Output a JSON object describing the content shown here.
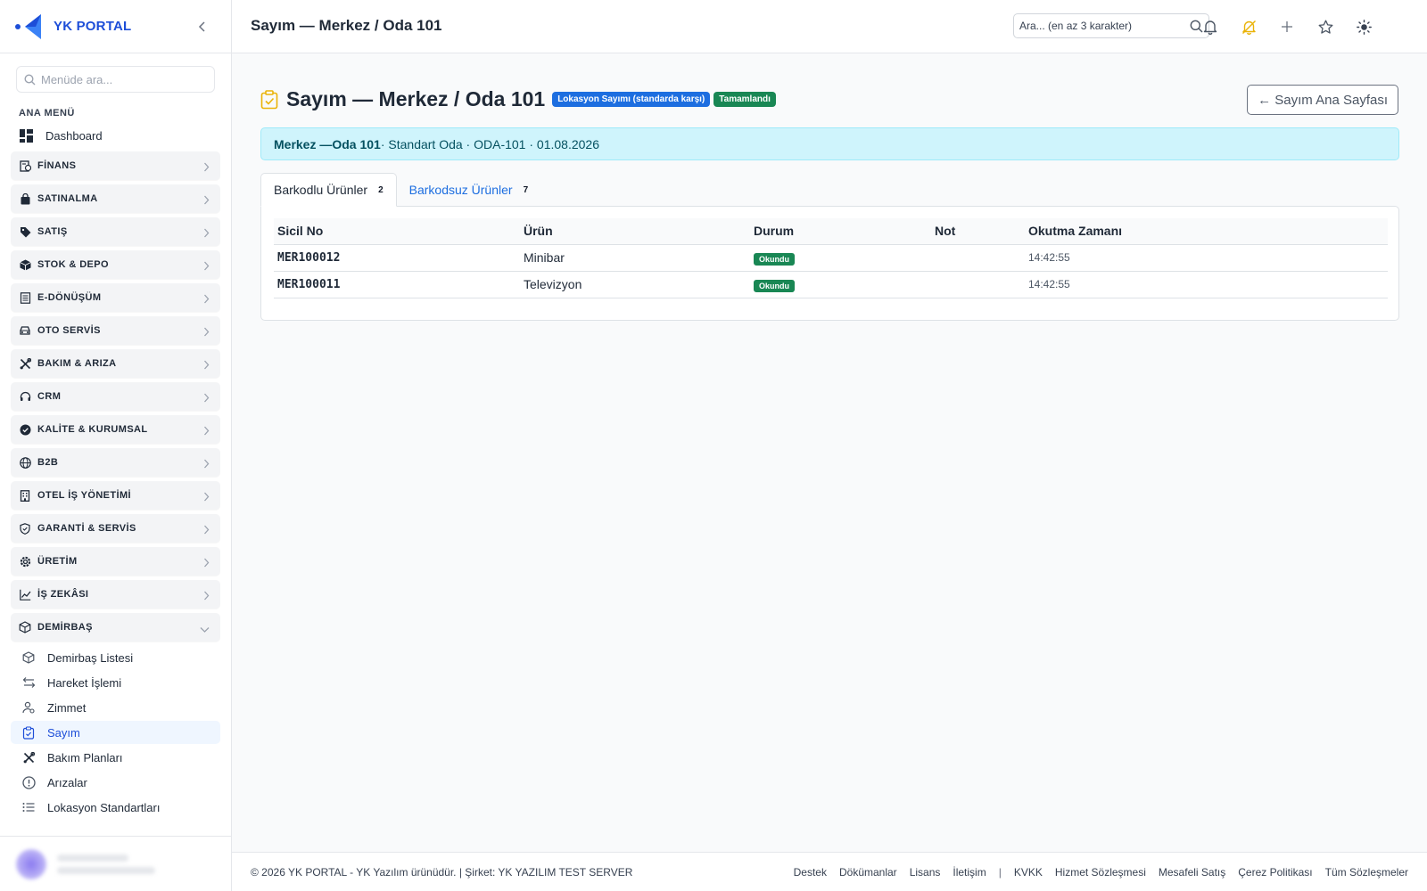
{
  "brand": {
    "name": "YK PORTAL"
  },
  "sidebar": {
    "search_placeholder": "Menüde ara...",
    "section_label": "ANA MENÜ",
    "dashboard": "Dashboard",
    "groups": [
      {
        "label": "FİNANS",
        "icon": "finance-icon"
      },
      {
        "label": "SATINALMA",
        "icon": "shopping-bag-icon"
      },
      {
        "label": "SATIŞ",
        "icon": "tag-icon"
      },
      {
        "label": "STOK & DEPO",
        "icon": "box-icon"
      },
      {
        "label": "E-DÖNÜŞÜM",
        "icon": "receipt-icon"
      },
      {
        "label": "OTO SERVİS",
        "icon": "car-icon"
      },
      {
        "label": "BAKIM & ARIZA",
        "icon": "tools-icon"
      },
      {
        "label": "CRM",
        "icon": "headset-icon"
      },
      {
        "label": "KALİTE & KURUMSAL",
        "icon": "award-icon"
      },
      {
        "label": "B2B",
        "icon": "globe-icon"
      },
      {
        "label": "OTEL İŞ YÖNETİMİ",
        "icon": "building-icon"
      },
      {
        "label": "GARANTİ & SERVİS",
        "icon": "shield-icon"
      },
      {
        "label": "ÜRETİM",
        "icon": "gear-icon"
      },
      {
        "label": "İŞ ZEKÂSI",
        "icon": "chart-icon"
      },
      {
        "label": "DEMİRBAŞ",
        "icon": "cube-icon"
      }
    ],
    "sub_items": [
      {
        "label": "Demirbaş Listesi",
        "icon": "cube-icon"
      },
      {
        "label": "Hareket İşlemi",
        "icon": "arrows-icon"
      },
      {
        "label": "Zimmet",
        "icon": "person-icon"
      },
      {
        "label": "Sayım",
        "icon": "clipboard-check-icon",
        "active": true
      },
      {
        "label": "Bakım Planları",
        "icon": "tools-icon"
      },
      {
        "label": "Arızalar",
        "icon": "alert-circle-icon"
      },
      {
        "label": "Lokasyon Standartları",
        "icon": "list-icon"
      }
    ]
  },
  "topbar": {
    "title": "Sayım — Merkez / Oda 101",
    "search_placeholder": "Ara... (en az 3 karakter)"
  },
  "page": {
    "title": "Sayım — Merkez / Oda 101",
    "badge_type": "Lokasyon Sayımı (standarda karşı)",
    "badge_status": "Tamamlandı",
    "back_button": "← Sayım Ana Sayfası",
    "info": {
      "location_prefix": "Merkez — ",
      "location_room": "Oda 101",
      "details": " · Standart Oda · ODA-101 · 01.08.2026"
    },
    "tabs": [
      {
        "label": "Barkodlu Ürünler",
        "count": "2"
      },
      {
        "label": "Barkodsuz Ürünler",
        "count": "7"
      }
    ],
    "table": {
      "headers": [
        "Sicil No",
        "Ürün",
        "Durum",
        "Not",
        "Okutma Zamanı"
      ],
      "rows": [
        {
          "sicil": "MER100012",
          "urun": "Minibar",
          "durum": "Okundu",
          "not": "",
          "zaman": "14:42:55"
        },
        {
          "sicil": "MER100011",
          "urun": "Televizyon",
          "durum": "Okundu",
          "not": "",
          "zaman": "14:42:55"
        }
      ]
    }
  },
  "footer": {
    "copyright": "© 2026 YK PORTAL - YK Yazılım ürünüdür. | Şirket: YK YAZILIM TEST SERVER",
    "links": [
      "Destek",
      "Dökümanlar",
      "Lisans",
      "İletişim"
    ],
    "separator": "|",
    "legal_links": [
      "KVKK",
      "Hizmet Sözleşmesi",
      "Mesafeli Satış",
      "Çerez Politikası",
      "Tüm Sözleşmeler"
    ]
  },
  "colors": {
    "accent": "#1d6ee0",
    "success": "#198754",
    "info_bg": "#cff4fc",
    "bell_accent": "#eab308"
  }
}
